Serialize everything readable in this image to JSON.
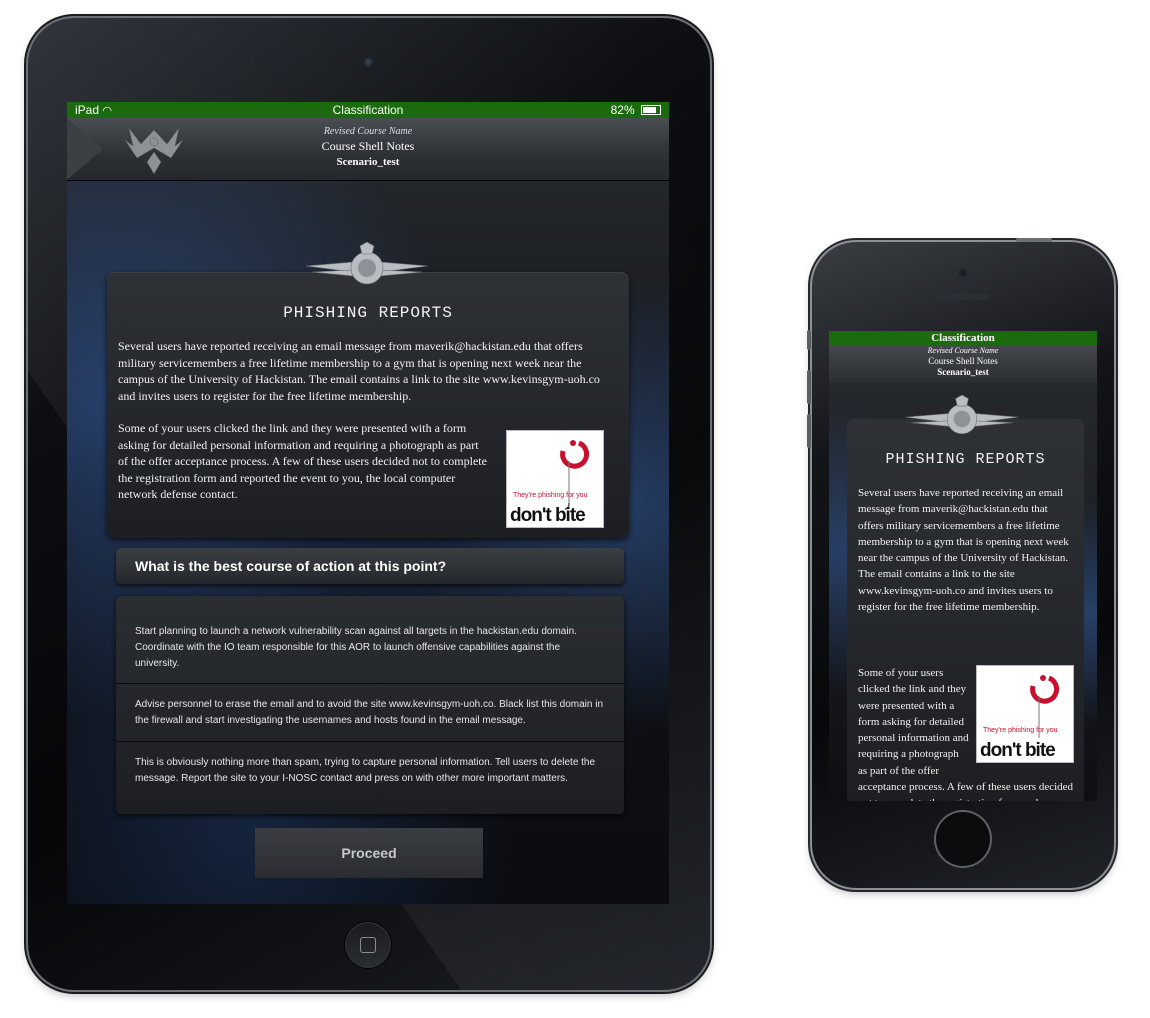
{
  "status_bar": {
    "device": "iPad",
    "center": "Classification",
    "battery": "82%"
  },
  "header": {
    "subtitle": "Revised Course Name",
    "title": "Course Shell Notes",
    "scenario": "Scenario_test"
  },
  "card": {
    "title": "PHISHING REPORTS",
    "paragraph1": "Several users have reported receiving an email message from maverik@hackistan.edu that offers military servicemembers a free lifetime membership to a gym that is opening next week near the campus of the University of Hackistan. The email contains a link to the site www.kevinsgym-uoh.co and invites users to register for the free lifetime membership.",
    "paragraph2": "Some of your users clicked the link and they were presented with a form asking for detailed personal information and requiring a photograph as part of the offer acceptance process. A few of these users decided not to complete the registration form and reported the event to you, the local computer network defense contact.",
    "image": {
      "caption_small": "They're phishing for you",
      "caption_large": "don't bite"
    }
  },
  "question": "What is the best course of action at this point?",
  "answers": [
    "Start planning to launch a network vulnerability scan against all targets in the hackistan.edu domain. Coordinate with the IO team responsible for this AOR to launch offensive capabilities against the university.",
    "Advise personnel to erase the email and to avoid the site www.kevinsgym-uoh.co. Black list this domain in the firewall and start investigating the usernames and hosts found in the email message.",
    "This is obviously nothing more than spam, trying to capture personal information. Tell users to delete the message. Report the site to your I-NOSC contact and press on with other more important matters."
  ],
  "proceed_label": "Proceed",
  "colors": {
    "status_green": "#1c6a0e",
    "accent_red": "#c8102e"
  }
}
